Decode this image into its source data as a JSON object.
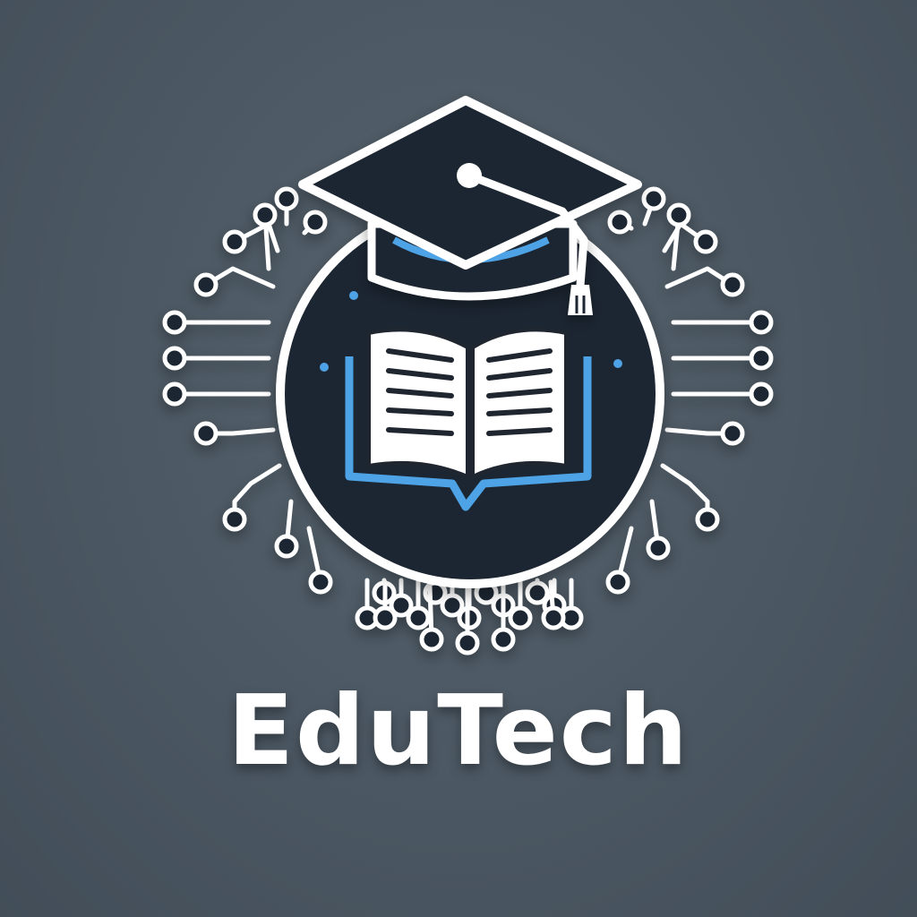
{
  "brand": {
    "name": "EduTech"
  },
  "colors": {
    "background": "#4b5762",
    "emblem_fill": "#1f2630",
    "line": "#ffffff",
    "accent": "#4da3e6"
  },
  "icons": {
    "cap": "graduation-cap-icon",
    "book": "open-book-icon",
    "circuit": "circuit-traces-icon"
  }
}
